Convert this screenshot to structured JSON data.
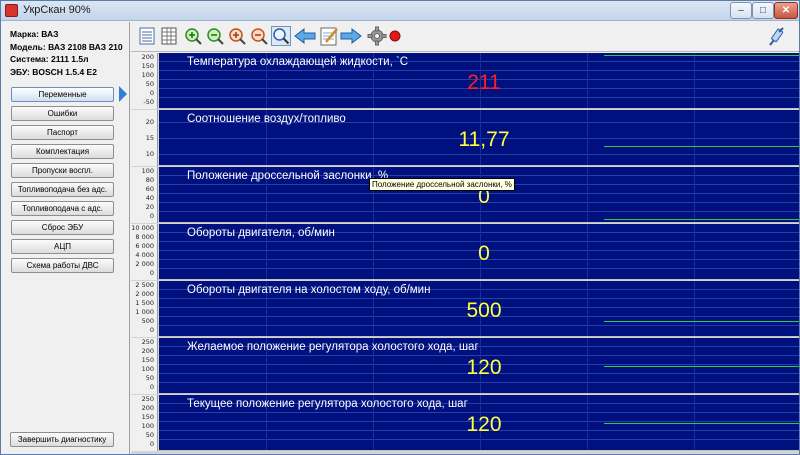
{
  "window": {
    "title": "УкрСкан 90%",
    "min_label": "–",
    "max_label": "□",
    "close_label": "✕"
  },
  "vehicle": {
    "make": "Марка: ВАЗ",
    "model": "Модель: ВАЗ 2108 ВАЗ 210",
    "system": "Система: 2111 1.5л",
    "ecu": "ЭБУ: BOSCH 1.5.4 E2"
  },
  "nav": {
    "items": [
      {
        "label": "Переменные",
        "active": true
      },
      {
        "label": "Ошибки"
      },
      {
        "label": "Паспорт"
      },
      {
        "label": "Комплектация"
      },
      {
        "label": "Пропуски воспл."
      },
      {
        "label": "Топливоподача без адс."
      },
      {
        "label": "Топливоподача с адс."
      },
      {
        "label": "Сброс ЭБУ"
      },
      {
        "label": "АЦП"
      },
      {
        "label": "Схема работы ДВС"
      }
    ],
    "finish_label": "Завершить диагностику"
  },
  "toolbar": {
    "icons": [
      "list-view-icon",
      "grid-view-icon",
      "zoom-in-icon",
      "zoom-out-icon",
      "zoom-in-vertical-icon",
      "zoom-out-vertical-icon",
      "search-icon",
      "back-arrow-icon",
      "notepad-icon",
      "forward-arrow-icon",
      "settings-icon",
      "record-icon",
      "connection-icon"
    ]
  },
  "colors": {
    "plot_bg": "#00107f",
    "value_yellow": "#ffff40",
    "value_red": "#ff2020",
    "trace_green": "#2ecc40"
  },
  "panels": [
    {
      "title": "Температура охлаждающей жидкости, `C",
      "value": "211",
      "value_color": "red",
      "ticks": [
        "200",
        "150",
        "100",
        "50",
        "0",
        "-50"
      ]
    },
    {
      "title": "Соотношение воздух/топливо",
      "value": "11,77",
      "ticks": [
        "20",
        "15",
        "10"
      ]
    },
    {
      "title": "Положение дроссельной заслонки, %",
      "value": "0",
      "ticks": [
        "100",
        "80",
        "60",
        "40",
        "20",
        "0"
      ]
    },
    {
      "title": "Обороты двигателя, об/мин",
      "value": "0",
      "ticks": [
        "10 000",
        "8 000",
        "6 000",
        "4 000",
        "2 000",
        "0"
      ]
    },
    {
      "title": "Обороты двигателя на холостом ходу, об/мин",
      "value": "500",
      "ticks": [
        "2 500",
        "2 000",
        "1 500",
        "1 000",
        "500",
        "0"
      ]
    },
    {
      "title": "Желаемое положение регулятора холостого хода, шаг",
      "value": "120",
      "ticks": [
        "250",
        "200",
        "150",
        "100",
        "50",
        "0"
      ]
    },
    {
      "title": "Текущее положение регулятора холостого хода, шаг",
      "value": "120",
      "ticks": [
        "250",
        "200",
        "150",
        "100",
        "50",
        "0"
      ]
    }
  ],
  "tooltip": "Положение дроссельной заслонки, %"
}
